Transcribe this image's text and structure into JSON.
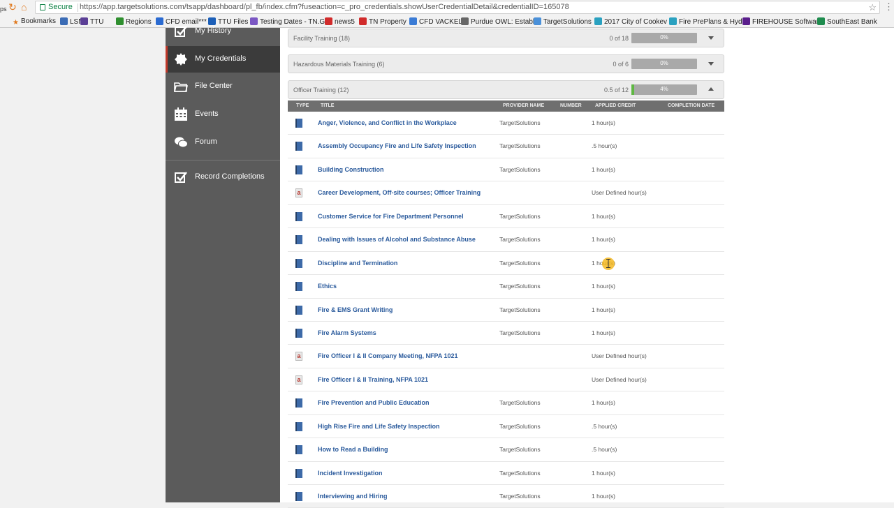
{
  "browser": {
    "secure_label": "Secure",
    "url": "https://app.targetsolutions.com/tsapp/dashboard/pl_fb/index.cfm?fuseaction=c_pro_credentials.showUserCredentialDetail&credentialID=165078",
    "nav_prefix": "ps",
    "bookmarks": [
      "Bookmarks",
      "LSN",
      "TTU",
      "Regions",
      "CFD email***",
      "TTU Files",
      "Testing Dates - TN.G",
      "news5",
      "TN Property",
      "CFD VACKEL",
      "Purdue OWL: Establ",
      "TargetSolutions",
      "2017 City of Cookev",
      "Fire PrePlans & Hyd",
      "FIREHOUSE Software",
      "SouthEast Bank"
    ]
  },
  "sidebar": {
    "items": [
      {
        "label": "My History",
        "icon": "checkbox-icon"
      },
      {
        "label": "My Credentials",
        "icon": "badge-icon"
      },
      {
        "label": "File Center",
        "icon": "folder-icon"
      },
      {
        "label": "Events",
        "icon": "calendar-icon"
      },
      {
        "label": "Forum",
        "icon": "chat-icon"
      },
      {
        "label": "Record Completions",
        "icon": "checkbox-icon"
      }
    ]
  },
  "panels": [
    {
      "title": "Facility Training (18)",
      "count": "0 of 18",
      "pct_label": "0%",
      "progress": 0,
      "expanded": false
    },
    {
      "title": "Hazardous Materials Training (6)",
      "count": "0 of 6",
      "pct_label": "0%",
      "progress": 0,
      "expanded": false
    },
    {
      "title": "Officer Training (12)",
      "count": "0.5 of 12",
      "pct_label": "4%",
      "progress": 0.04,
      "expanded": true
    }
  ],
  "table": {
    "headers": {
      "type": "TYPE",
      "title": "TITLE",
      "provider": "PROVIDER NAME",
      "number": "NUMBER",
      "credit": "APPLIED CREDIT",
      "completion": "COMPLETION DATE"
    },
    "rows": [
      {
        "type": "book",
        "title": "Anger, Violence, and Conflict in the Workplace",
        "provider": "TargetSolutions",
        "credit": "1 hour(s)"
      },
      {
        "type": "book",
        "title": "Assembly Occupancy Fire and Life Safety Inspection",
        "provider": "TargetSolutions",
        "credit": ".5 hour(s)"
      },
      {
        "type": "book",
        "title": "Building Construction",
        "provider": "TargetSolutions",
        "credit": "1 hour(s)"
      },
      {
        "type": "external",
        "title": "Career Development, Off-site courses; Officer Training",
        "provider": "",
        "credit": "User Defined hour(s)"
      },
      {
        "type": "book",
        "title": "Customer Service for Fire Department Personnel",
        "provider": "TargetSolutions",
        "credit": "1 hour(s)"
      },
      {
        "type": "book",
        "title": "Dealing with Issues of Alcohol and Substance Abuse",
        "provider": "TargetSolutions",
        "credit": "1 hour(s)"
      },
      {
        "type": "book",
        "title": "Discipline and Termination",
        "provider": "TargetSolutions",
        "credit": "1 hour(s)"
      },
      {
        "type": "book",
        "title": "Ethics",
        "provider": "TargetSolutions",
        "credit": "1 hour(s)"
      },
      {
        "type": "book",
        "title": "Fire & EMS Grant Writing",
        "provider": "TargetSolutions",
        "credit": "1 hour(s)"
      },
      {
        "type": "book",
        "title": "Fire Alarm Systems",
        "provider": "TargetSolutions",
        "credit": "1 hour(s)"
      },
      {
        "type": "external",
        "title": "Fire Officer I & II Company Meeting, NFPA 1021",
        "provider": "",
        "credit": "User Defined hour(s)"
      },
      {
        "type": "external",
        "title": "Fire Officer I & II Training, NFPA 1021",
        "provider": "",
        "credit": "User Defined hour(s)"
      },
      {
        "type": "book",
        "title": "Fire Prevention and Public Education",
        "provider": "TargetSolutions",
        "credit": "1 hour(s)"
      },
      {
        "type": "book",
        "title": "High Rise Fire and Life Safety Inspection",
        "provider": "TargetSolutions",
        "credit": ".5 hour(s)"
      },
      {
        "type": "book",
        "title": "How to Read a Building",
        "provider": "TargetSolutions",
        "credit": ".5 hour(s)"
      },
      {
        "type": "book",
        "title": "Incident Investigation",
        "provider": "TargetSolutions",
        "credit": "1 hour(s)"
      },
      {
        "type": "book",
        "title": "Interviewing and Hiring",
        "provider": "TargetSolutions",
        "credit": "1 hour(s)"
      }
    ]
  },
  "colors": {
    "sidebar": "#5b5b5b",
    "active_accent": "#c0392b",
    "link": "#2a5a9c",
    "progress_fill": "#5fb843"
  }
}
